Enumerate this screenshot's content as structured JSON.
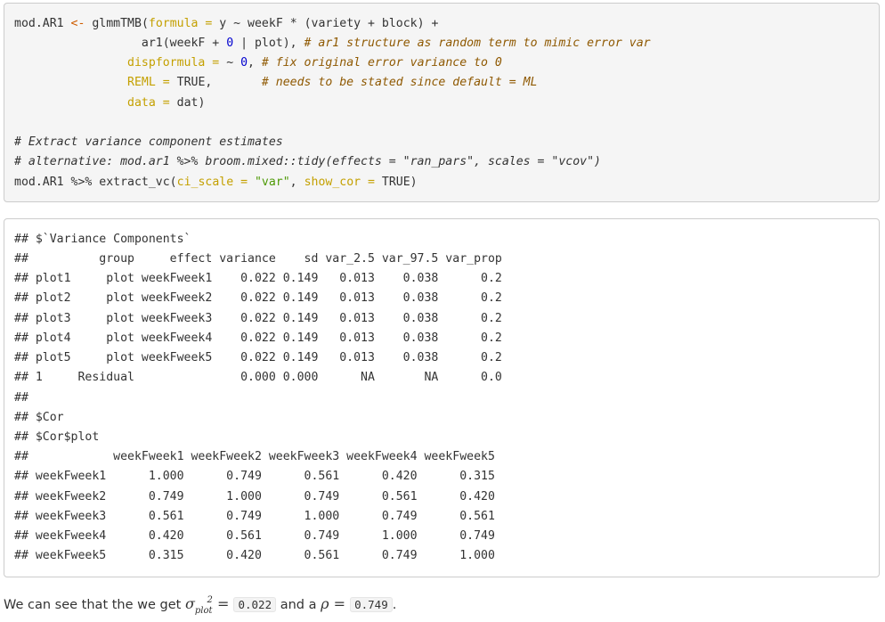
{
  "code": {
    "l1_a": "mod.AR1 ",
    "l1_op": "<-",
    "l1_b": " glmmTMB(",
    "l1_arg": "formula",
    "l1_eq": " = ",
    "l1_c": "y ~ weekF * (variety + block) +",
    "l2_a": "                  ar1(weekF + ",
    "l2_num": "0",
    "l2_b": " | plot), ",
    "l2_com": "# ar1 structure as random term to mimic error var",
    "l3_arg": "                dispformula = ",
    "l3_a": "~ ",
    "l3_num": "0",
    "l3_b": ", ",
    "l3_com": "# fix original error variance to 0",
    "l4_arg": "                REML = ",
    "l4_a": "TRUE,       ",
    "l4_com": "# needs to be stated since default = ML",
    "l5_arg": "                data = ",
    "l5_a": "dat)",
    "l7": "# Extract variance component estimates",
    "l8": "# alternative: mod.ar1 %>% broom.mixed::tidy(effects = \"ran_pars\", scales = \"vcov\")",
    "l9_a": "mod.AR1 %>% extract_vc(",
    "l9_arg1": "ci_scale = ",
    "l9_str": "\"var\"",
    "l9_b": ", ",
    "l9_arg2": "show_cor = ",
    "l9_c": "TRUE)"
  },
  "output": [
    "## $`Variance Components`",
    "##          group     effect variance    sd var_2.5 var_97.5 var_prop",
    "## plot1     plot weekFweek1    0.022 0.149   0.013    0.038      0.2",
    "## plot2     plot weekFweek2    0.022 0.149   0.013    0.038      0.2",
    "## plot3     plot weekFweek3    0.022 0.149   0.013    0.038      0.2",
    "## plot4     plot weekFweek4    0.022 0.149   0.013    0.038      0.2",
    "## plot5     plot weekFweek5    0.022 0.149   0.013    0.038      0.2",
    "## 1     Residual               0.000 0.000      NA       NA      0.0",
    "##",
    "## $Cor",
    "## $Cor$plot",
    "##            weekFweek1 weekFweek2 weekFweek3 weekFweek4 weekFweek5",
    "## weekFweek1      1.000      0.749      0.561      0.420      0.315",
    "## weekFweek2      0.749      1.000      0.749      0.561      0.420",
    "## weekFweek3      0.561      0.749      1.000      0.749      0.561",
    "## weekFweek4      0.420      0.561      0.749      1.000      0.749",
    "## weekFweek5      0.315      0.420      0.561      0.749      1.000"
  ],
  "prose": {
    "text1": "We can see that the we get ",
    "sigma": "σ",
    "sup": "2",
    "sub": "plot",
    "eq1": " = ",
    "val1": "0.022",
    "text2": " and a ",
    "rho": "ρ",
    "eq2": " = ",
    "val2": "0.749",
    "end": "."
  }
}
